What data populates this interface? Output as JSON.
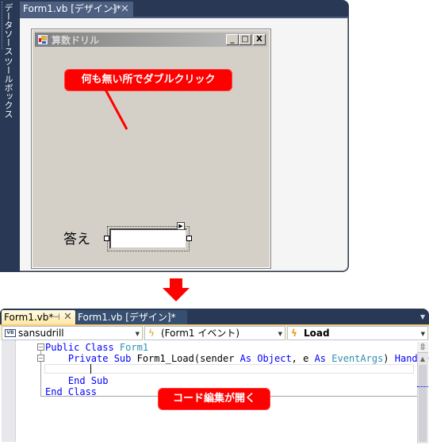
{
  "designer": {
    "side_panels": [
      "データソース",
      "ツールボックス"
    ],
    "tab": {
      "label": "Form1.vb [デザイン]*",
      "pin_icon": "⊣",
      "close_icon": "✕"
    },
    "form": {
      "title": "算数ドリル",
      "buttons": {
        "minimize": "_",
        "maximize": "□",
        "close": "X"
      },
      "answer_label": "答え",
      "textbox_value": ""
    },
    "callout": "何も無い所でダブルクリック"
  },
  "arrow": {
    "icon": "down-arrow",
    "color": "#ff0000"
  },
  "code_editor": {
    "tabs": [
      {
        "label": "Form1.vb*",
        "active": true
      },
      {
        "label": "Form1.vb [デザイン]*",
        "active": false
      }
    ],
    "nav": {
      "class_dropdown": "sansudrill",
      "vb_badge": "VB",
      "object_dropdown": "(Form1 イベント)",
      "method_dropdown": "Load"
    },
    "code": [
      {
        "tokens": [
          {
            "t": "Public Class ",
            "c": "kw"
          },
          {
            "t": "Form1",
            "c": "ty"
          }
        ]
      },
      {
        "tokens": [
          {
            "t": "    Private Sub ",
            "c": "kw"
          },
          {
            "t": "Form1_Load(sender ",
            "c": "tx"
          },
          {
            "t": "As Object",
            "c": "kw"
          },
          {
            "t": ", e ",
            "c": "tx"
          },
          {
            "t": "As ",
            "c": "kw"
          },
          {
            "t": "EventArgs",
            "c": "ty"
          },
          {
            "t": ") ",
            "c": "tx"
          },
          {
            "t": "Handle",
            "c": "kw"
          }
        ]
      },
      {
        "tokens": [
          {
            "t": "",
            "c": "tx"
          }
        ]
      },
      {
        "tokens": [
          {
            "t": "    End Sub",
            "c": "kw"
          }
        ]
      },
      {
        "tokens": [
          {
            "t": "End Class",
            "c": "kw"
          }
        ]
      }
    ],
    "callout": "コード編集が開く"
  },
  "colors": {
    "ide_frame": "#293955",
    "callout": "#ff0000",
    "keyword": "#0000ff",
    "type": "#2b91af"
  }
}
